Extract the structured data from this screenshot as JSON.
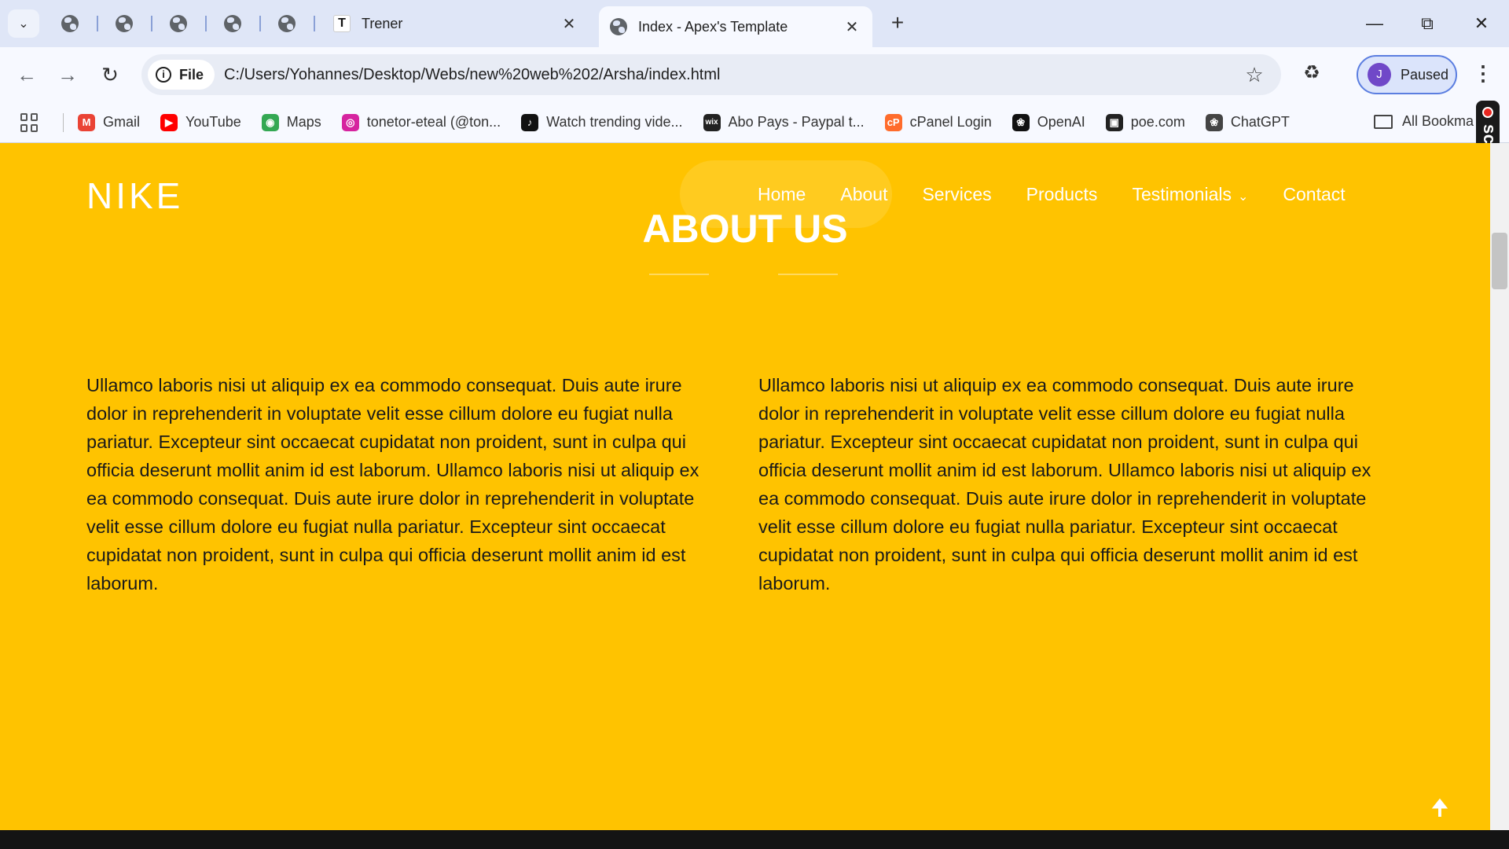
{
  "browser": {
    "tabs": [
      {
        "title": "Trener",
        "favicon": "T"
      },
      {
        "title": "Index - Apex's Template",
        "favicon": "globe-icon",
        "active": true
      }
    ],
    "url": "C:/Users/Yohannes/Desktop/Webs/new%20web%202/Arsha/index.html",
    "site_chip": "File",
    "profile": {
      "initial": "J",
      "status": "Paused"
    },
    "bookmarks": [
      {
        "label": "Gmail",
        "icon": "gmail-icon",
        "color": "#ea4335"
      },
      {
        "label": "YouTube",
        "icon": "youtube-icon",
        "color": "#ff0000"
      },
      {
        "label": "Maps",
        "icon": "maps-icon",
        "color": "#34a853"
      },
      {
        "label": "tonetor-eteal (@ton...",
        "icon": "instagram-icon",
        "color": "#d6249f"
      },
      {
        "label": "Watch trending vide...",
        "icon": "tiktok-icon",
        "color": "#111111"
      },
      {
        "label": "Abo Pays - Paypal t...",
        "icon": "wix-icon",
        "color": "#222222"
      },
      {
        "label": "cPanel Login",
        "icon": "cpanel-icon",
        "color": "#ff6c2c"
      },
      {
        "label": "OpenAI",
        "icon": "openai-icon",
        "color": "#111111"
      },
      {
        "label": "poe.com",
        "icon": "poe-icon",
        "color": "#222222"
      },
      {
        "label": "ChatGPT",
        "icon": "chatgpt-icon",
        "color": "#444444"
      }
    ],
    "all_bookmarks": "All Bookma",
    "screenrec_label": "screenrec"
  },
  "site": {
    "logo": "NIKE",
    "nav": [
      "Home",
      "About",
      "Services",
      "Products",
      "Testimonials",
      "Contact"
    ],
    "section_title": "ABOUT US",
    "paragraph_left": "Ullamco laboris nisi ut aliquip ex ea commodo consequat. Duis aute irure dolor in reprehenderit in voluptate velit esse cillum dolore eu fugiat nulla pariatur. Excepteur sint occaecat cupidatat non proident, sunt in culpa qui officia deserunt mollit anim id est laborum. Ullamco laboris nisi ut aliquip ex ea commodo consequat. Duis aute irure dolor in reprehenderit in voluptate velit esse cillum dolore eu fugiat nulla pariatur. Excepteur sint occaecat cupidatat non proident, sunt in culpa qui officia deserunt mollit anim id est laborum.",
    "paragraph_right": "Ullamco laboris nisi ut aliquip ex ea commodo consequat. Duis aute irure dolor in reprehenderit in voluptate velit esse cillum dolore eu fugiat nulla pariatur. Excepteur sint occaecat cupidatat non proident, sunt in culpa qui officia deserunt mollit anim id est laborum. Ullamco laboris nisi ut aliquip ex ea commodo consequat. Duis aute irure dolor in reprehenderit in voluptate velit esse cillum dolore eu fugiat nulla pariatur. Excepteur sint occaecat cupidatat non proident, sunt in culpa qui officia deserunt mollit anim id est laborum.",
    "colors": {
      "background": "#ffc300",
      "text": "#1a1a1a",
      "heading": "#ffffff"
    }
  }
}
